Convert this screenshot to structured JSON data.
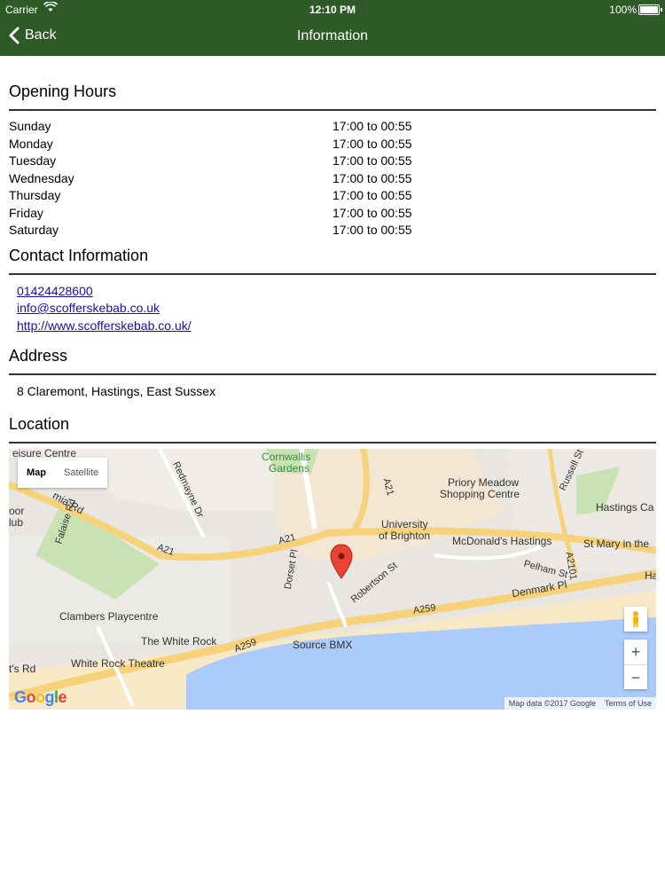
{
  "status_bar": {
    "carrier": "Carrier",
    "time": "12:10 PM",
    "battery": "100%"
  },
  "nav": {
    "back_label": "Back",
    "title": "Information"
  },
  "colors": {
    "header": "#2d5a26",
    "link": "#1a0dab"
  },
  "opening_hours": {
    "heading": "Opening Hours",
    "rows": [
      {
        "day": "Sunday",
        "hours": "17:00 to 00:55"
      },
      {
        "day": "Monday",
        "hours": "17:00 to 00:55"
      },
      {
        "day": "Tuesday",
        "hours": "17:00 to 00:55"
      },
      {
        "day": "Wednesday",
        "hours": "17:00 to 00:55"
      },
      {
        "day": "Thursday",
        "hours": "17:00 to 00:55"
      },
      {
        "day": "Friday",
        "hours": "17:00 to 00:55"
      },
      {
        "day": "Saturday",
        "hours": "17:00 to 00:55"
      }
    ]
  },
  "contact": {
    "heading": "Contact Information",
    "phone": "01424428600",
    "email": "info@scofferskebab.co.uk",
    "website": "http://www.scofferskebab.co.uk/"
  },
  "address": {
    "heading": "Address",
    "text": "8 Claremont, Hastings, East Sussex"
  },
  "location": {
    "heading": "Location",
    "map": {
      "tab_map": "Map",
      "tab_satellite": "Satellite",
      "zoom_in": "+",
      "zoom_out": "−",
      "logo": "Google",
      "attribution": "Map data ©2017 Google",
      "terms": "Terms of Use",
      "labels": {
        "leisure": "eisure Centre",
        "cornwallis": "Cornwallis",
        "gardens": "Gardens",
        "priory1": "Priory Meadow",
        "priory2": "Shopping Centre",
        "russell": "Russell St",
        "hastings_ca": "Hastings Ca",
        "redmayne": "Redmayne Dr",
        "university1": "University",
        "university2": "of Brighton",
        "mcdonalds": "McDonald's Hastings",
        "st_mary": "St Mary in the",
        "pelham": "Pelham St",
        "ha": "Ha",
        "robertson": "Robertson St",
        "dorset": "Dorset Pl",
        "denmark": "Denmark Pl",
        "falaise": "Falaise Rd",
        "mia_rd": "mia Rd",
        "oor": "oor",
        "lub": "lub",
        "clambers": "Clambers Playcentre",
        "white_rock": "The White Rock",
        "source_bmx": "Source BMX",
        "white_rock_theatre": "White Rock Theatre",
        "ts_rd": "t's Rd",
        "a21_1": "A21",
        "a21_2": "A21",
        "a21_3": "A21",
        "a259_1": "A259",
        "a259_2": "A259",
        "a2101": "A2101"
      }
    }
  }
}
